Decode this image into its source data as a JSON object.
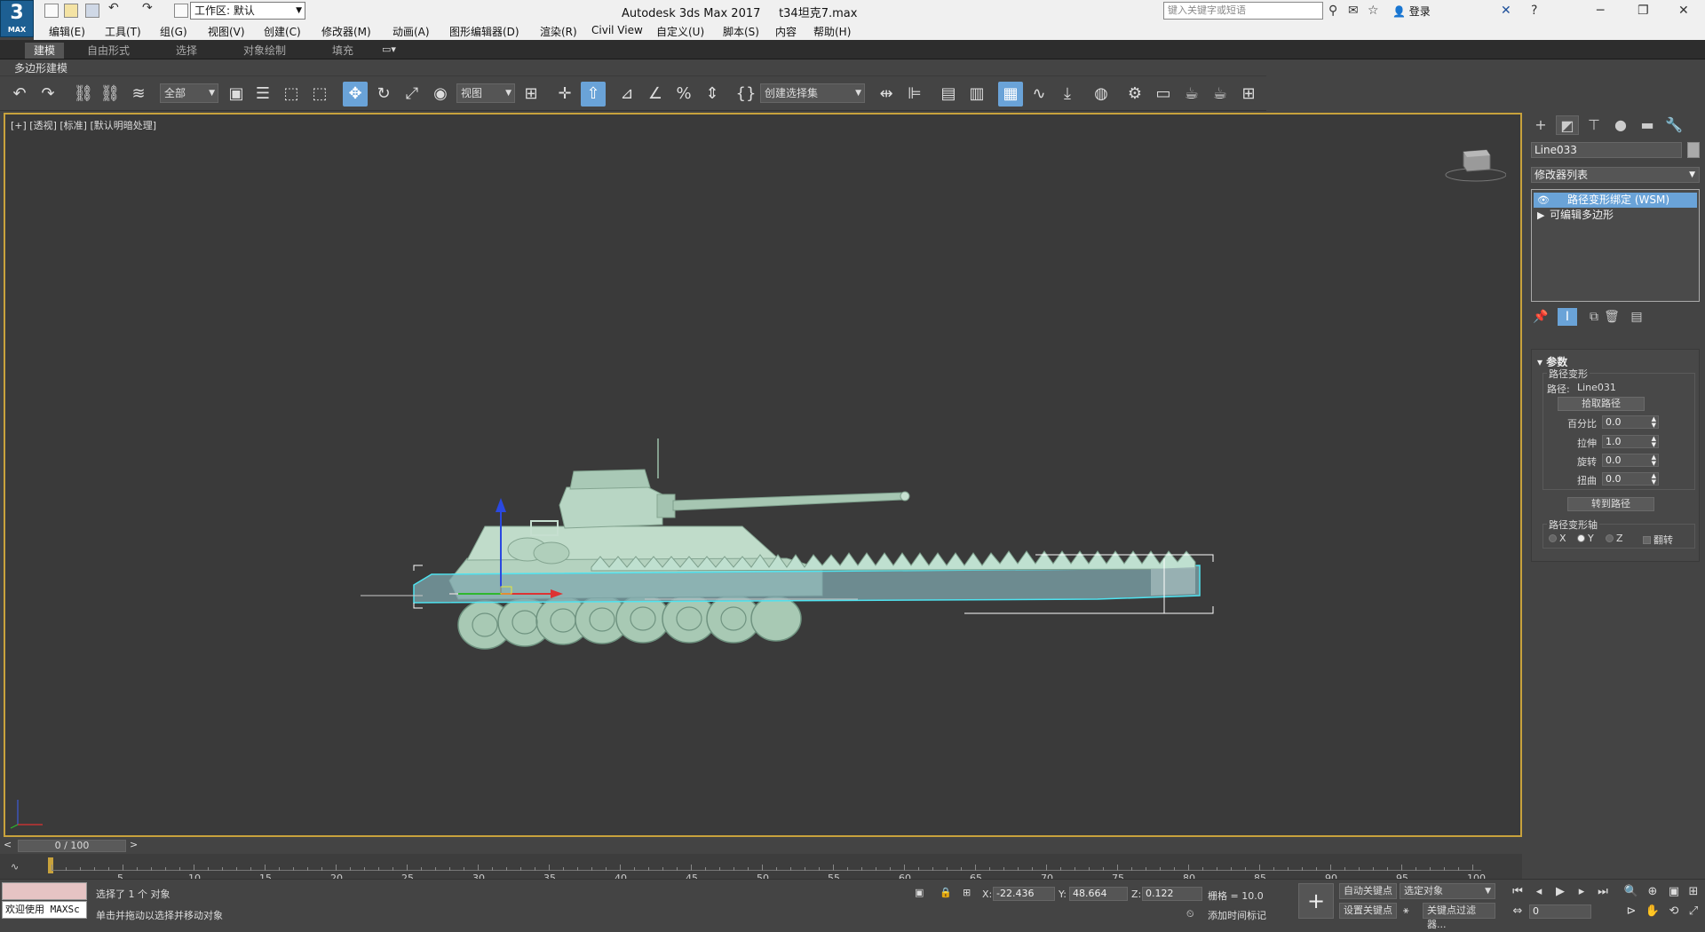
{
  "app": {
    "logo_number": "3",
    "logo_sub": "MAX",
    "window_title": "Autodesk 3ds Max 2017",
    "file_name": "t34坦克7.max",
    "workspace": "工作区: 默认",
    "search_placeholder": "键入关键字或短语",
    "login": "登录"
  },
  "menu": [
    "编辑(E)",
    "工具(T)",
    "组(G)",
    "视图(V)",
    "创建(C)",
    "修改器(M)",
    "动画(A)",
    "图形编辑器(D)",
    "渲染(R)",
    "Civil View",
    "自定义(U)",
    "脚本(S)",
    "内容",
    "帮助(H)"
  ],
  "ribbon": {
    "tabs": [
      "建模",
      "自由形式",
      "选择",
      "对象绘制",
      "填充"
    ],
    "active": "建模",
    "subtitle": "多边形建模"
  },
  "toolbar": {
    "filter": "全部",
    "coord_system": "视图",
    "selection_set": "创建选择集"
  },
  "viewport": {
    "label": "[+] [透视] [标准] [默认明暗处理]"
  },
  "command_panel": {
    "object_name": "Line033",
    "modifier_list": "修改器列表",
    "stack": [
      {
        "label": "路径变形绑定 (WSM)",
        "selected": true
      },
      {
        "label": "可编辑多边形",
        "selected": false
      }
    ],
    "rollout_title": "参数",
    "path_deform_group": "路径变形",
    "path_label": "路径:",
    "path_value": "Line031",
    "pick_path": "拾取路径",
    "params": [
      {
        "label": "百分比",
        "value": "0.0"
      },
      {
        "label": "拉伸",
        "value": "1.0"
      },
      {
        "label": "旋转",
        "value": "0.0"
      },
      {
        "label": "扭曲",
        "value": "0.0"
      }
    ],
    "move_to_path": "转到路径",
    "axis_group": "路径变形轴",
    "axes": [
      {
        "label": "X",
        "selected": false
      },
      {
        "label": "Y",
        "selected": true
      },
      {
        "label": "Z",
        "selected": false
      }
    ],
    "flip": "翻转"
  },
  "timeline": {
    "frame": "0 / 100",
    "ticks": [
      "0",
      "5",
      "10",
      "15",
      "20",
      "25",
      "30",
      "35",
      "40",
      "45",
      "50",
      "55",
      "60",
      "65",
      "70",
      "75",
      "80",
      "85",
      "90",
      "95",
      "100"
    ]
  },
  "status": {
    "maxscript": "欢迎使用 MAXSc",
    "selection": "选择了 1 个 对象",
    "prompt": "单击并拖动以选择并移动对象",
    "x_label": "X:",
    "x": "-22.436",
    "y_label": "Y:",
    "y": "48.664",
    "z_label": "Z:",
    "z": "0.122",
    "grid": "栅格 = 10.0",
    "add_time_tag": "添加时间标记",
    "auto_key": "自动关键点",
    "selected_obj": "选定对象",
    "set_key": "设置关键点",
    "key_filter": "关键点过滤器...",
    "current_frame": "0"
  }
}
